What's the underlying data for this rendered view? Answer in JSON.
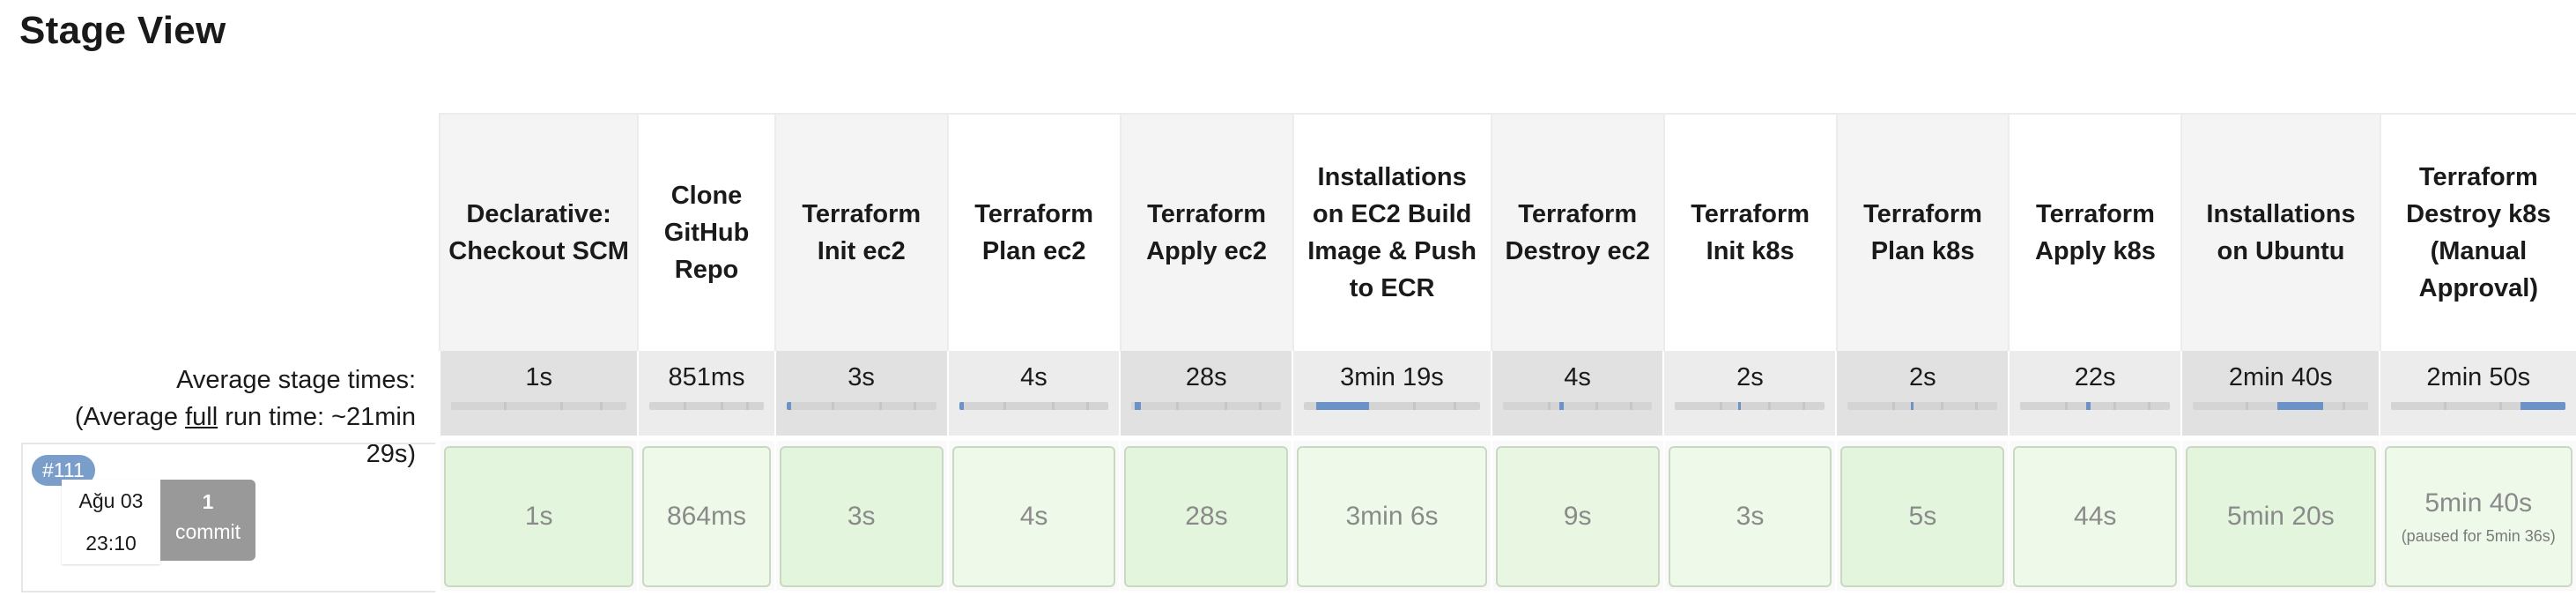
{
  "page": {
    "title": "Stage View"
  },
  "summary": {
    "avg_line1": "Average stage times:",
    "avg_line2_prefix": "(Average ",
    "avg_line2_link": "full",
    "avg_line2_suffix": " run time: ~21min",
    "avg_line3": "29s)"
  },
  "stages": [
    {
      "name": "Declarative: Checkout SCM",
      "avg": "1s",
      "run": "1s"
    },
    {
      "name": "Clone GitHub Repo",
      "avg": "851ms",
      "run": "864ms"
    },
    {
      "name": "Terraform Init ec2",
      "avg": "3s",
      "run": "3s"
    },
    {
      "name": "Terraform Plan ec2",
      "avg": "4s",
      "run": "4s"
    },
    {
      "name": "Terraform Apply ec2",
      "avg": "28s",
      "run": "28s"
    },
    {
      "name": "Installations on EC2 Build Image & Push to ECR",
      "avg": "3min 19s",
      "run": "3min 6s"
    },
    {
      "name": "Terraform Destroy ec2",
      "avg": "4s",
      "run": "9s"
    },
    {
      "name": "Terraform Init k8s",
      "avg": "2s",
      "run": "3s"
    },
    {
      "name": "Terraform Plan k8s",
      "avg": "2s",
      "run": "5s"
    },
    {
      "name": "Terraform Apply k8s",
      "avg": "22s",
      "run": "44s"
    },
    {
      "name": "Installations on Ubuntu",
      "avg": "2min 40s",
      "run": "5min 20s"
    },
    {
      "name": "Terraform Destroy k8s (Manual Approval)",
      "avg": "2min 50s",
      "run": "5min 40s",
      "run_note": "(paused for 5min 36s)"
    }
  ],
  "build": {
    "number": "#111",
    "date": "Ağu 03",
    "time": "23:10",
    "commit_count": "1",
    "commit_label": "commit"
  }
}
